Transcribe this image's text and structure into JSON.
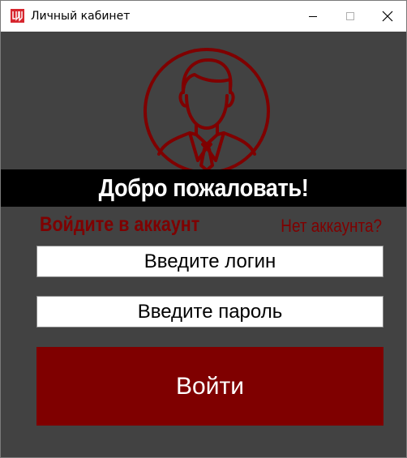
{
  "window": {
    "title": "Личный кабинет"
  },
  "header": {
    "welcome": "Добро пожаловать!"
  },
  "login": {
    "heading": "Войдите в аккаунт",
    "register_link": "Нет аккаунта?",
    "username_placeholder": "Введите логин",
    "username_value": "",
    "password_placeholder": "Введите пароль",
    "password_value": "",
    "submit_label": "Войти"
  },
  "colors": {
    "background": "#424242",
    "accent": "#7f0000",
    "banner": "#000000"
  },
  "icons": {
    "app": "lukoil-logo-icon",
    "avatar": "user-avatar-icon",
    "minimize": "minimize-icon",
    "maximize": "maximize-icon",
    "close": "close-icon"
  }
}
